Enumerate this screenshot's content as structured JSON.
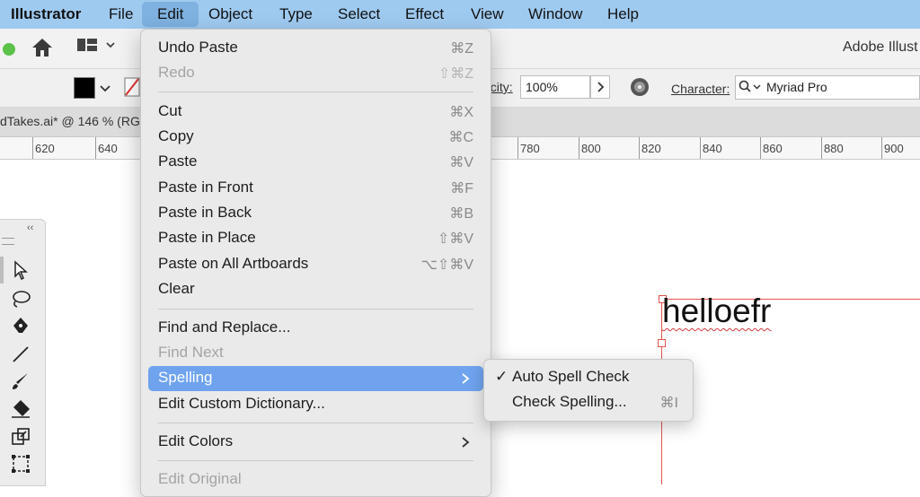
{
  "menubar": {
    "app": "Illustrator",
    "items": [
      "File",
      "Edit",
      "Object",
      "Type",
      "Select",
      "Effect",
      "View",
      "Window",
      "Help"
    ],
    "active": "Edit"
  },
  "appbar": {
    "title": "Adobe Illust"
  },
  "controlbar": {
    "opacity_label": "acity:",
    "opacity_value": "100%",
    "character_label": "Character:",
    "font_value": "Myriad Pro"
  },
  "document": {
    "tab_title": "dTakes.ai* @ 146 % (RG"
  },
  "ruler": {
    "labels": [
      "620",
      "640",
      "780",
      "800",
      "820",
      "840",
      "860",
      "880",
      "900"
    ]
  },
  "edit_menu": {
    "items": [
      {
        "label": "Undo Paste",
        "shortcut": "⌘Z",
        "disabled": false
      },
      {
        "label": "Redo",
        "shortcut": "⇧⌘Z",
        "disabled": true
      },
      {
        "label": "Cut",
        "shortcut": "⌘X",
        "disabled": false
      },
      {
        "label": "Copy",
        "shortcut": "⌘C",
        "disabled": false
      },
      {
        "label": "Paste",
        "shortcut": "⌘V",
        "disabled": false
      },
      {
        "label": "Paste in Front",
        "shortcut": "⌘F",
        "disabled": false
      },
      {
        "label": "Paste in Back",
        "shortcut": "⌘B",
        "disabled": false
      },
      {
        "label": "Paste in Place",
        "shortcut": "⇧⌘V",
        "disabled": false
      },
      {
        "label": "Paste on All Artboards",
        "shortcut": "⌥⇧⌘V",
        "disabled": false
      },
      {
        "label": "Clear",
        "shortcut": "",
        "disabled": false
      },
      {
        "label": "Find and Replace...",
        "shortcut": "",
        "disabled": false
      },
      {
        "label": "Find Next",
        "shortcut": "",
        "disabled": true
      },
      {
        "label": "Spelling",
        "shortcut": "",
        "disabled": false,
        "highlighted": true,
        "submenu": true
      },
      {
        "label": "Edit Custom Dictionary...",
        "shortcut": "",
        "disabled": false
      },
      {
        "label": "Edit Colors",
        "shortcut": "",
        "disabled": false,
        "submenu": true
      },
      {
        "label": "Edit Original",
        "shortcut": "",
        "disabled": true
      }
    ]
  },
  "spelling_submenu": {
    "items": [
      {
        "label": "Auto Spell Check",
        "checked": true,
        "shortcut": ""
      },
      {
        "label": "Check Spelling...",
        "checked": false,
        "shortcut": "⌘I"
      }
    ]
  },
  "canvas": {
    "text": "helloefr"
  },
  "colors": {
    "menubar": "#9fcaf0",
    "highlight": "#6fa3ee",
    "artboard_edge": "#e3544f"
  }
}
